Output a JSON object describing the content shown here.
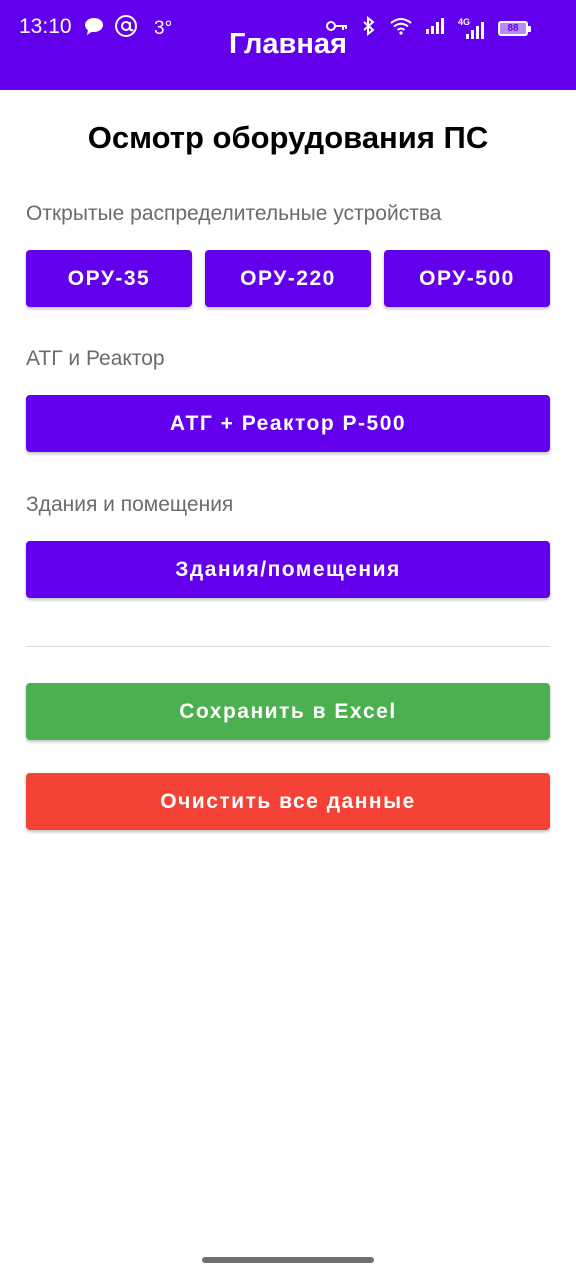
{
  "status_bar": {
    "time": "13:10",
    "temperature": "3°",
    "battery": "88",
    "network": "4G"
  },
  "app_bar": {
    "title": "Главная"
  },
  "main": {
    "title": "Осмотр оборудования ПС",
    "sections": [
      {
        "label": "Открытые распределительные устройства",
        "buttons": [
          "ОРУ-35",
          "ОРУ-220",
          "ОРУ-500"
        ]
      },
      {
        "label": "АТГ и Реактор",
        "buttons": [
          "АТГ + Реактор Р-500"
        ]
      },
      {
        "label": "Здания и помещения",
        "buttons": [
          "Здания/помещения"
        ]
      }
    ],
    "actions": {
      "save_label": "Сохранить в Excel",
      "clear_label": "Очистить все данные"
    }
  },
  "colors": {
    "primary": "#6200ee",
    "save": "#4caf50",
    "clear": "#f44336"
  }
}
